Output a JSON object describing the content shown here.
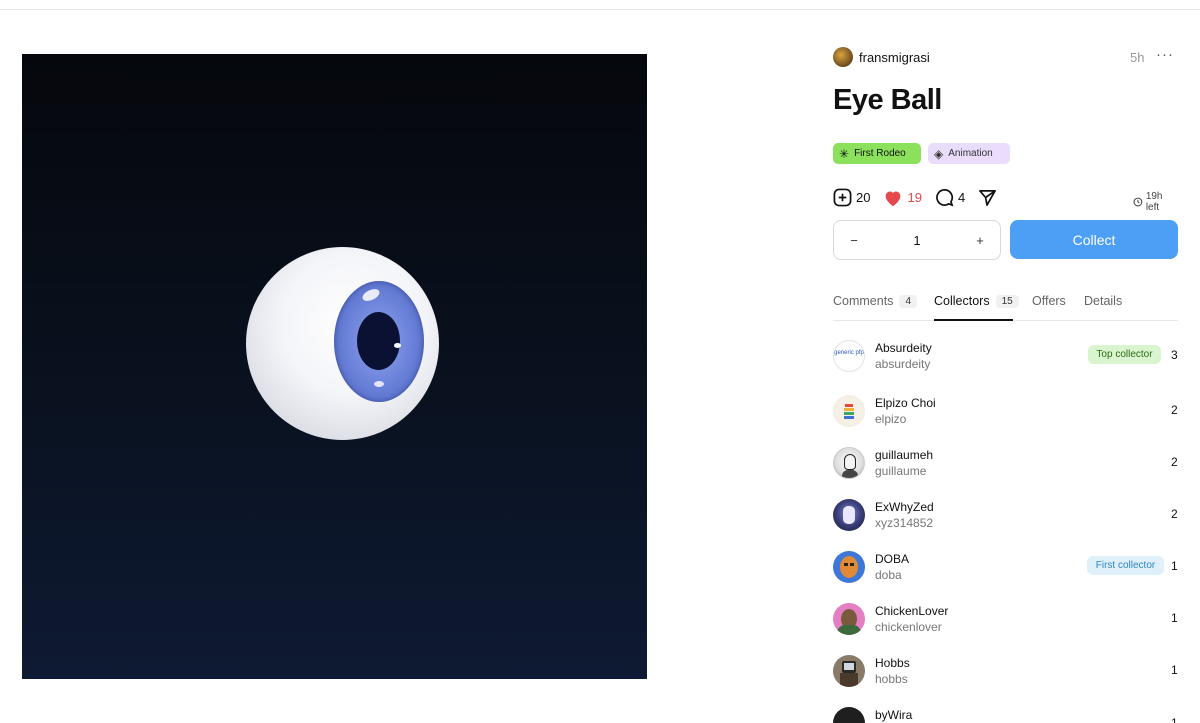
{
  "artwork": {
    "alt": "eyeball animation"
  },
  "creator": {
    "name": "fransmigrasi",
    "time": "5h",
    "more": "···"
  },
  "title": "Eye Ball",
  "tags": [
    {
      "label": "First Rodeo",
      "icon": "asterisk-icon"
    },
    {
      "label": "Animation",
      "icon": "diamond-icon"
    }
  ],
  "stats": {
    "collects": "20",
    "likes": "19",
    "comments": "4",
    "time_left": "19h left"
  },
  "stepper": {
    "minus": "−",
    "value": "1",
    "plus": "+"
  },
  "collect_button": "Collect",
  "tabs": [
    {
      "label": "Comments",
      "count": "4"
    },
    {
      "label": "Collectors",
      "count": "15",
      "active": true
    },
    {
      "label": "Offers"
    },
    {
      "label": "Details"
    }
  ],
  "collectors": [
    {
      "name": "Absurdeity",
      "handle": "absurdeity",
      "count": "3",
      "badge": "Top collector",
      "avatar_text": "generic pfp"
    },
    {
      "name": "Elpizo Choi",
      "handle": "elpizo",
      "count": "2"
    },
    {
      "name": "guillaumeh",
      "handle": "guillaume",
      "count": "2"
    },
    {
      "name": "ExWhyZed",
      "handle": "xyz314852",
      "count": "2"
    },
    {
      "name": "DOBA",
      "handle": "doba",
      "count": "1",
      "badge": "First collector"
    },
    {
      "name": "ChickenLover",
      "handle": "chickenlover",
      "count": "1"
    },
    {
      "name": "Hobbs",
      "handle": "hobbs",
      "count": "1"
    },
    {
      "name": "byWira",
      "handle": "",
      "count": "1"
    }
  ],
  "colors": {
    "accent": "#4c9ff5",
    "like": "#e5484d",
    "tag_rodeo": "#8be15b",
    "tag_anim": "#e9ddfb"
  }
}
